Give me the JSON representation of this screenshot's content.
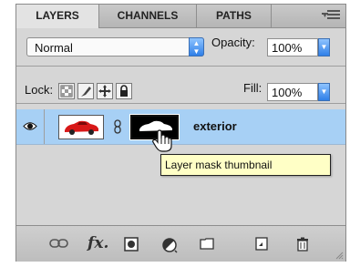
{
  "tabs": [
    {
      "label": "LAYERS",
      "active": true
    },
    {
      "label": "CHANNELS",
      "active": false
    },
    {
      "label": "PATHS",
      "active": false
    }
  ],
  "blend": {
    "mode": "Normal",
    "opacity_label": "Opacity:",
    "opacity_value": "100%"
  },
  "lock": {
    "label": "Lock:",
    "fill_label": "Fill:",
    "fill_value": "100%"
  },
  "layer": {
    "name": "exterior",
    "visible": true
  },
  "tooltip": "Layer mask thumbnail",
  "icons": [
    "link-layers-icon",
    "fx-icon",
    "add-mask-icon",
    "adjustment-layer-icon",
    "new-group-icon",
    "new-layer-icon",
    "trash-icon"
  ],
  "colors": {
    "selected_row": "#a7d0f5",
    "accent": "#2f7fe8",
    "tooltip_bg": "#ffffc6"
  }
}
